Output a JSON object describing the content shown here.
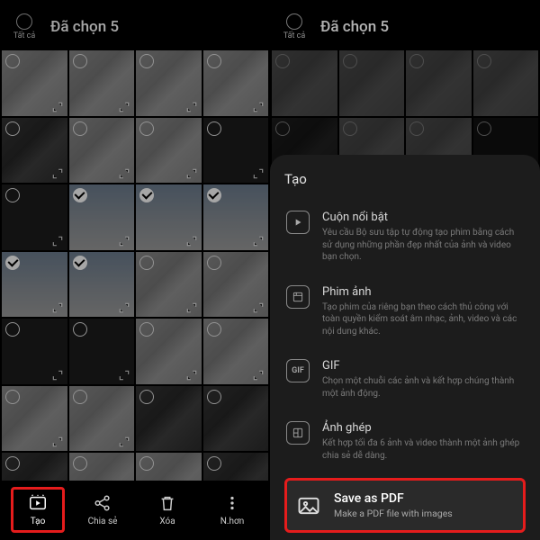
{
  "left": {
    "all_label": "Tất cả",
    "title": "Đã chọn 5",
    "bottom": {
      "create": "Tạo",
      "share": "Chia sẻ",
      "delete": "Xóa",
      "more": "N.hơn"
    }
  },
  "right": {
    "all_label": "Tất cả",
    "title": "Đã chọn 5",
    "sheet": {
      "heading": "Tạo",
      "highlight": {
        "title": "Cuộn nổi bật",
        "sub": "Yêu cầu Bộ sưu tập tự động tạo phim bằng cách sử dụng những phần đẹp nhất của ảnh và video bạn chọn."
      },
      "movie": {
        "title": "Phim ảnh",
        "sub": "Tạo phim của riêng bạn theo cách thủ công với toàn quyền kiểm soát âm nhạc, ảnh, video và các nội dung khác."
      },
      "gif": {
        "title": "GIF",
        "sub": "Chọn một chuỗi các ảnh và kết hợp chúng thành một ảnh động.",
        "badge": "GIF"
      },
      "collage": {
        "title": "Ảnh ghép",
        "sub": "Kết hợp tối đa 6 ảnh và video thành một ảnh ghép chia sẻ dễ dàng."
      },
      "pdf": {
        "title": "Save as PDF",
        "sub": "Make a PDF file with images"
      }
    }
  }
}
